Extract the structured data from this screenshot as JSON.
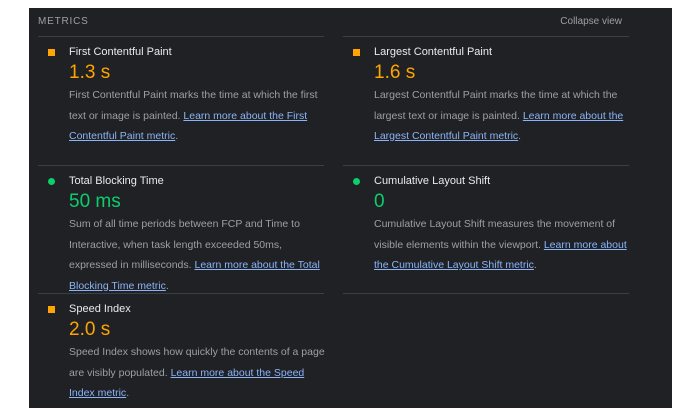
{
  "section": {
    "title": "METRICS",
    "toggle_label": "Collapse view"
  },
  "colors": {
    "average": "#ffa400",
    "pass": "#0cce6b",
    "link": "#8ab4f8",
    "background": "#202124"
  },
  "metrics": [
    {
      "title": "First Contentful Paint",
      "value": "1.3 s",
      "status": "average",
      "description": "First Contentful Paint marks the time at which the first text or image is painted.",
      "link": "Learn more about the First Contentful Paint metric",
      "end": "."
    },
    {
      "title": "Largest Contentful Paint",
      "value": "1.6 s",
      "status": "average",
      "description": "Largest Contentful Paint marks the time at which the largest text or image is painted.",
      "link": "Learn more about the Largest Contentful Paint metric",
      "end": "."
    },
    {
      "title": "Total Blocking Time",
      "value": "50 ms",
      "status": "pass",
      "description": "Sum of all time periods between FCP and Time to Interactive, when task length exceeded 50ms, expressed in milliseconds.",
      "link": "Learn more about the Total Blocking Time metric",
      "end": "."
    },
    {
      "title": "Cumulative Layout Shift",
      "value": "0",
      "status": "pass",
      "description": "Cumulative Layout Shift measures the movement of visible elements within the viewport.",
      "link": "Learn more about the Cumulative Layout Shift metric",
      "end": "."
    },
    {
      "title": "Speed Index",
      "value": "2.0 s",
      "status": "average",
      "description": "Speed Index shows how quickly the contents of a page are visibly populated.",
      "link": "Learn more about the Speed Index metric",
      "end": "."
    }
  ]
}
